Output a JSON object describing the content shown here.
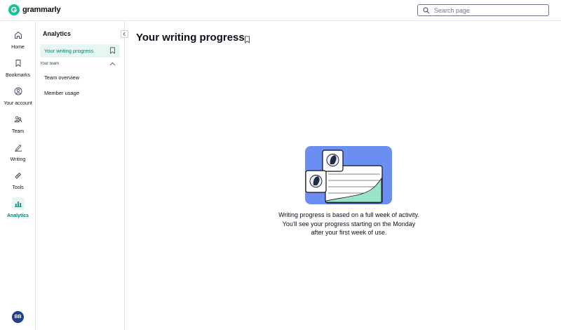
{
  "header": {
    "brand": "grammarly",
    "search_placeholder": "Search page"
  },
  "rail": {
    "items": [
      {
        "label": "Home",
        "icon": "home-icon"
      },
      {
        "label": "Bookmarks",
        "icon": "bookmark-icon"
      },
      {
        "label": "Your account",
        "icon": "user-icon"
      },
      {
        "label": "Team",
        "icon": "team-icon"
      },
      {
        "label": "Writing",
        "icon": "pen-icon"
      },
      {
        "label": "Tools",
        "icon": "tools-icon"
      },
      {
        "label": "Analytics",
        "icon": "bar-chart-icon",
        "active": true
      }
    ],
    "avatar_initials": "BB"
  },
  "sidebar": {
    "title": "Analytics",
    "active_item": "Your writing progress",
    "section_label": "Your team",
    "section_items": [
      "Team overview",
      "Member usage"
    ]
  },
  "main": {
    "title": "Your writing progress",
    "empty_message": "Writing progress is based on a full week of activity. You'll see your progress starting on the Monday after your first week of use."
  },
  "colors": {
    "accent": "#027e6f",
    "active_bg": "#e6f6f1",
    "brand_green": "#15c39a",
    "avatar_bg": "#1f3f8f",
    "illustration_blue": "#6a8ff0"
  }
}
